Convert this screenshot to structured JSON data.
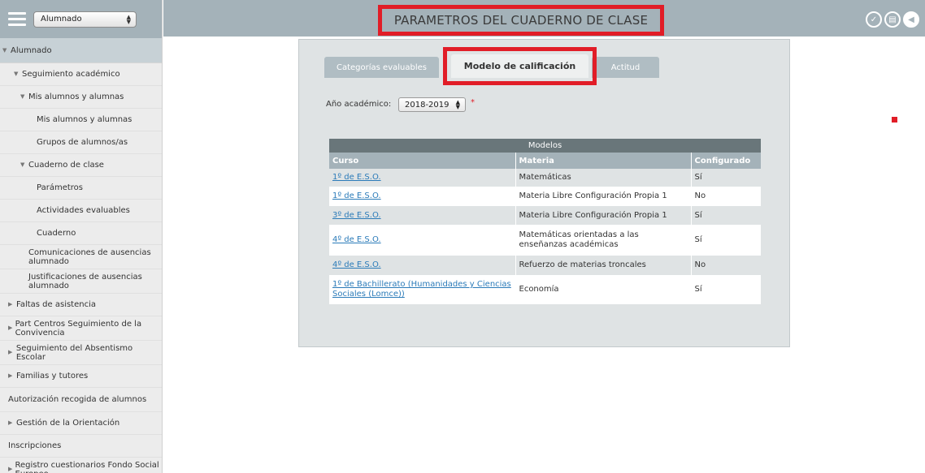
{
  "sidebar": {
    "profile_select": "Alumnado",
    "head": "Alumnado",
    "items": [
      {
        "label": "Seguimiento académico"
      },
      {
        "label": "Mis alumnos y alumnas"
      },
      {
        "label": "Mis alumnos y alumnas"
      },
      {
        "label": "Grupos de alumnos/as"
      },
      {
        "label": "Cuaderno de clase"
      },
      {
        "label": "Parámetros"
      },
      {
        "label": "Actividades evaluables"
      },
      {
        "label": "Cuaderno"
      },
      {
        "label": "Comunicaciones de ausencias alumnado"
      },
      {
        "label": "Justificaciones de ausencias alumnado"
      },
      {
        "label": "Faltas de asistencia"
      },
      {
        "label": "Part Centros Seguimiento de la Convivencia"
      },
      {
        "label": "Seguimiento del Absentismo Escolar"
      },
      {
        "label": "Familias y tutores"
      },
      {
        "label": "Autorización recogida de alumnos"
      },
      {
        "label": "Gestión de la Orientación"
      },
      {
        "label": "Inscripciones"
      },
      {
        "label": "Registro cuestionarios Fondo Social Europeo"
      }
    ]
  },
  "header": {
    "title": "PARAMETROS DEL CUADERNO DE CLASE",
    "icons": [
      "check-icon",
      "document-icon",
      "back-arrow-icon"
    ]
  },
  "tabs": [
    {
      "label": "Categorías evaluables"
    },
    {
      "label": "Modelo de calificación"
    },
    {
      "label": "Actitud"
    }
  ],
  "form": {
    "ano_label": "Año académico:",
    "ano_value": "2018-2019",
    "required_mark": "*"
  },
  "table": {
    "caption": "Modelos",
    "headers": [
      "Curso",
      "Materia",
      "Configurado"
    ],
    "rows": [
      {
        "curso": "1º de E.S.O.",
        "materia": "Matemáticas",
        "configurado": "Sí"
      },
      {
        "curso": "1º de E.S.O.",
        "materia": "Materia Libre Configuración Propia 1",
        "configurado": "No"
      },
      {
        "curso": "3º de E.S.O.",
        "materia": "Materia Libre Configuración Propia 1",
        "configurado": "Sí"
      },
      {
        "curso": "4º de E.S.O.",
        "materia": "Matemáticas orientadas a las enseñanzas académicas",
        "configurado": "Sí"
      },
      {
        "curso": "4º de E.S.O.",
        "materia": "Refuerzo de materias troncales",
        "configurado": "No"
      },
      {
        "curso": "1º de Bachillerato (Humanidades y Ciencias Sociales (Lomce))",
        "materia": "Economía",
        "configurado": "Sí"
      }
    ]
  },
  "colors": {
    "header_bg": "#a4b2b9",
    "highlight_red": "#e11d27",
    "link": "#2b7bb9"
  }
}
